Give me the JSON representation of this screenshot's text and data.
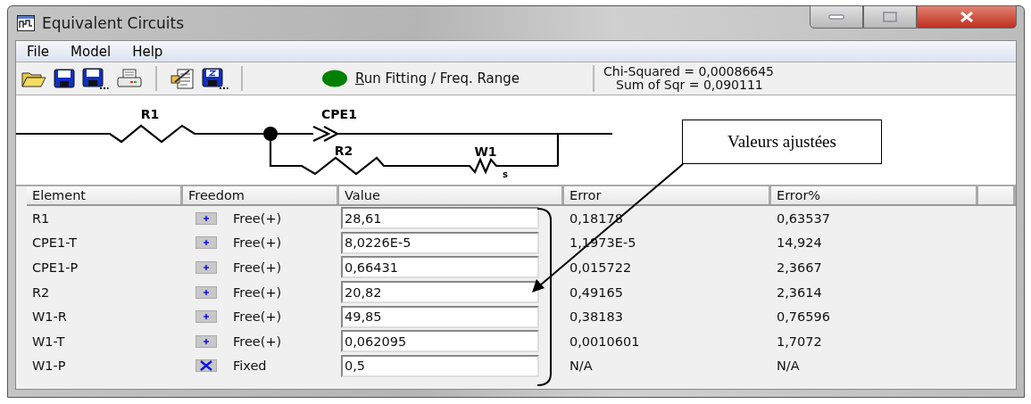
{
  "window": {
    "title": "Equivalent Circuits"
  },
  "menu": [
    "File",
    "Model",
    "Help"
  ],
  "toolbar": {
    "run_button": {
      "label": "Run Fitting / Freq. Range",
      "mnemonic_underlined": true,
      "color": "#008000"
    },
    "chi_squared": "Chi-Squared = 0,00086645",
    "sum_of_squares": "Sum of Sqr = 0,090111"
  },
  "circuit": {
    "labels": [
      "R1",
      "CPE1",
      "R2",
      "W1"
    ],
    "warburg_subscript": "s"
  },
  "table": {
    "columns": [
      "Element",
      "Freedom",
      "Value",
      "Error",
      "Error%"
    ],
    "rows": [
      {
        "element": "R1",
        "fixed": false,
        "freedom": "Free(+)",
        "value": "28,61",
        "error": "0,18178",
        "error_pct": "0,63537"
      },
      {
        "element": "CPE1-T",
        "fixed": false,
        "freedom": "Free(+)",
        "value": "8,0226E-5",
        "error": "1,1973E-5",
        "error_pct": "14,924"
      },
      {
        "element": "CPE1-P",
        "fixed": false,
        "freedom": "Free(+)",
        "value": "0,66431",
        "error": "0,015722",
        "error_pct": "2,3667"
      },
      {
        "element": "R2",
        "fixed": false,
        "freedom": "Free(+)",
        "value": "20,82",
        "error": "0,49165",
        "error_pct": "2,3614"
      },
      {
        "element": "W1-R",
        "fixed": false,
        "freedom": "Free(+)",
        "value": "49,85",
        "error": "0,38183",
        "error_pct": "0,76596"
      },
      {
        "element": "W1-T",
        "fixed": false,
        "freedom": "Free(+)",
        "value": "0,062095",
        "error": "0,0010601",
        "error_pct": "1,7072"
      },
      {
        "element": "W1-P",
        "fixed": true,
        "freedom": "Fixed",
        "value": "0,5",
        "error": "N/A",
        "error_pct": "N/A"
      }
    ]
  },
  "annotation": {
    "label": "Valeurs ajustées"
  }
}
